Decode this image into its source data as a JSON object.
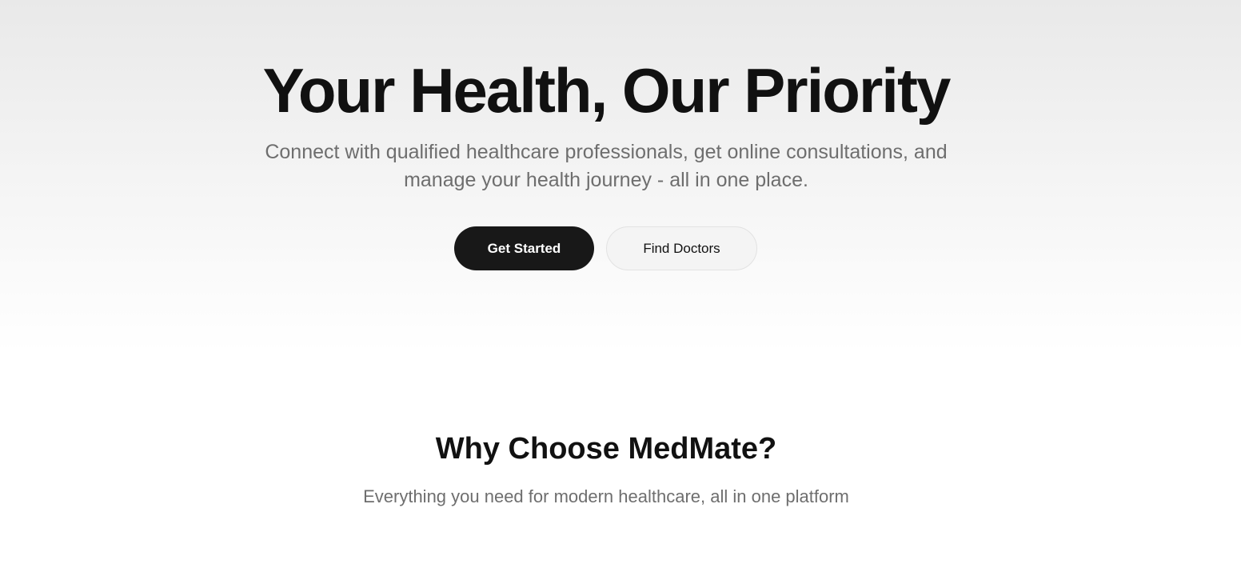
{
  "hero": {
    "title": "Your Health, Our Priority",
    "subtitle": "Connect with qualified healthcare professionals, get online consultations, and manage your health journey - all in one place.",
    "primary_button": "Get Started",
    "secondary_button": "Find Doctors"
  },
  "features": {
    "title": "Why Choose MedMate?",
    "subtitle": "Everything you need for modern healthcare, all in one platform"
  },
  "colors": {
    "primary_button_bg": "#181818",
    "secondary_button_bg": "#f4f4f4",
    "text": "#111111",
    "muted_text": "#6e6e6e"
  }
}
